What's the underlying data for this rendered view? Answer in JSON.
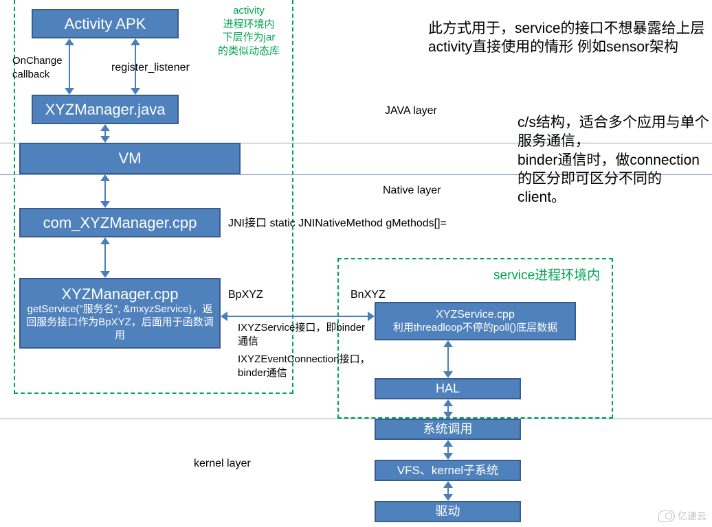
{
  "activity_region_title": "activity\n进程环境内\n下层作为jar\n的类似动态库",
  "service_region_title": "service进程环境内",
  "boxes": {
    "apk": "Activity APK",
    "manager_java": "XYZManager.java",
    "vm": "VM",
    "jni_cpp": "com_XYZManager.cpp",
    "mgr_cpp": {
      "title": "XYZManager.cpp",
      "sub": "getService(\"服务名\", &mxyzService)，返回服务接口作为BpXYZ，后面用于函数调用"
    },
    "service_cpp": {
      "title": "XYZService.cpp",
      "sub": "利用threadloop不停的poll()底层数据"
    },
    "hal": "HAL",
    "syscall": "系统调用",
    "vfs": "VFS、kernel子系统",
    "driver": "驱动"
  },
  "labels": {
    "onchange": "OnChange\ncallback",
    "register": "register_listener",
    "java_layer": "JAVA layer",
    "native_layer": "Native layer",
    "jni_note": "JNI接口   static JNINativeMethod gMethods[]=",
    "bpxyz": "BpXYZ",
    "bnxyz": "BnXYZ",
    "ixyz_service": "IXYZService接口，即binder通信",
    "ixyz_event": "IXYZEventConnection接口，binder通信",
    "kernel_layer": "kernel layer",
    "desc1": "此方式用于，service的接口不想暴露给上层activity直接使用的情形 例如sensor架构",
    "desc2": "c/s结构，适合多个应用与单个服务通信，\nbinder通信时，做connection的区分即可区分不同的client。"
  },
  "watermark": "亿速云"
}
